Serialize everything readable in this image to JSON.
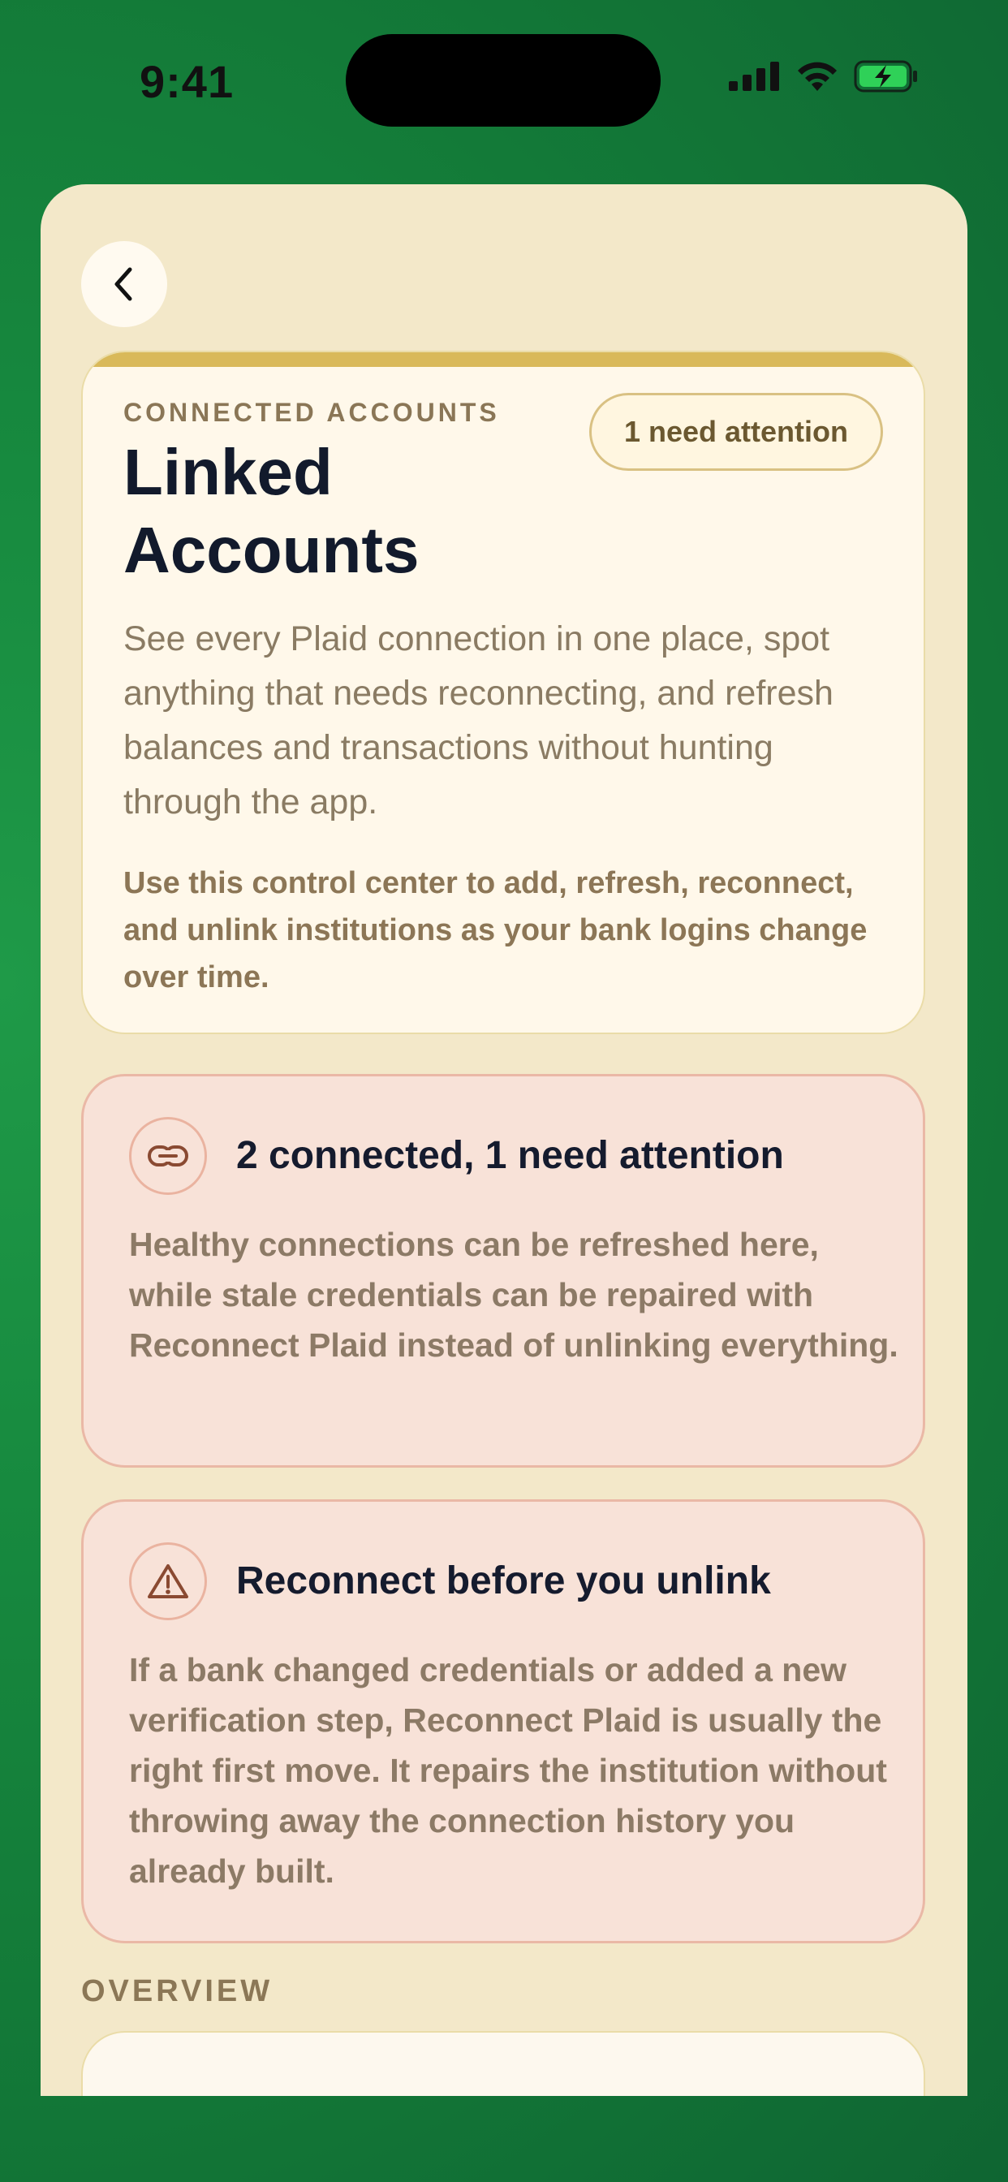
{
  "status": {
    "time": "9:41"
  },
  "hero": {
    "eyebrow": "CONNECTED ACCOUNTS",
    "badge": "1 need attention",
    "title_line1": "Linked",
    "title_line2": "Accounts",
    "description": "See every Plaid connection in one place, spot anything that needs reconnecting, and refresh balances and transactions without hunting through the app.",
    "note": "Use this control center to add, refresh, reconnect, and unlink institutions as your bank logins change over time."
  },
  "connection_card": {
    "icon": "link-icon",
    "title": "2 connected, 1 need attention",
    "body": "Healthy connections can be refreshed here, while stale credentials can be repaired with Reconnect Plaid instead of unlinking everything."
  },
  "reconnect_card": {
    "icon": "warning-icon",
    "title": "Reconnect before you unlink",
    "body": "If a bank changed credentials or added a new verification step, Reconnect Plaid is usually the right first move. It repairs the institution without throwing away the connection history you already built."
  },
  "overview": {
    "label": "OVERVIEW"
  },
  "colors": {
    "background_green": "#178a3f",
    "sheet": "#f3e8c9",
    "accent_gold": "#d9b95a",
    "alert_card": "#f8e2d8"
  }
}
